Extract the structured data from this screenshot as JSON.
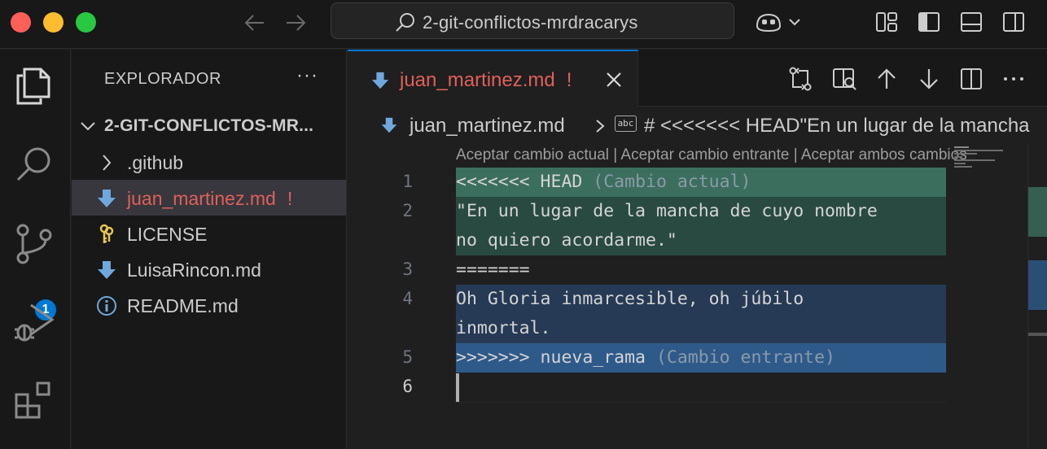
{
  "window": {
    "command_center_text": "2-git-conflictos-mrdracarys"
  },
  "activity": {
    "source_control_badge": "1"
  },
  "explorer": {
    "title": "EXPLORADOR",
    "more_label": "···",
    "folder": "2-GIT-CONFLICTOS-MR...",
    "items": [
      {
        "name": ".github",
        "type": "folder",
        "icon": "chevron-right-icon"
      },
      {
        "name": "juan_martinez.md",
        "type": "file",
        "icon": "markdown-icon",
        "status": "!",
        "selected": true
      },
      {
        "name": "LICENSE",
        "type": "file",
        "icon": "license-key-icon"
      },
      {
        "name": "LuisaRincon.md",
        "type": "file",
        "icon": "markdown-icon"
      },
      {
        "name": "README.md",
        "type": "file",
        "icon": "info-icon"
      }
    ]
  },
  "editor": {
    "tab_label": "juan_martinez.md",
    "tab_status": "!",
    "breadcrumb": {
      "file": "juan_martinez.md",
      "symbol_badge": "abc",
      "symbol": "# <<<<<<< HEAD\"En un lugar de la mancha"
    },
    "codelens": "Aceptar cambio actual | Aceptar cambio entrante | Aceptar ambos cambios",
    "line_numbers": [
      "1",
      "2",
      "3",
      "4",
      "5",
      "6"
    ],
    "lines": {
      "l1_code": "<<<<<<< HEAD",
      "l1_tag": " (Cambio actual)",
      "l2a": "\"En un lugar de la mancha de cuyo nombre",
      "l2b": "no quiero acordarme.\"",
      "l3": "=======",
      "l4a": "Oh Gloria inmarcesible, oh júbilo",
      "l4b": "inmortal.",
      "l5_code": ">>>>>>> nueva_rama",
      "l5_tag": " (Cambio entrante)"
    }
  },
  "colors": {
    "accent": "#0078d4",
    "conflict": "#e0605a",
    "current_change": "#3c6e5e",
    "incoming_change": "#2e5a8a"
  }
}
